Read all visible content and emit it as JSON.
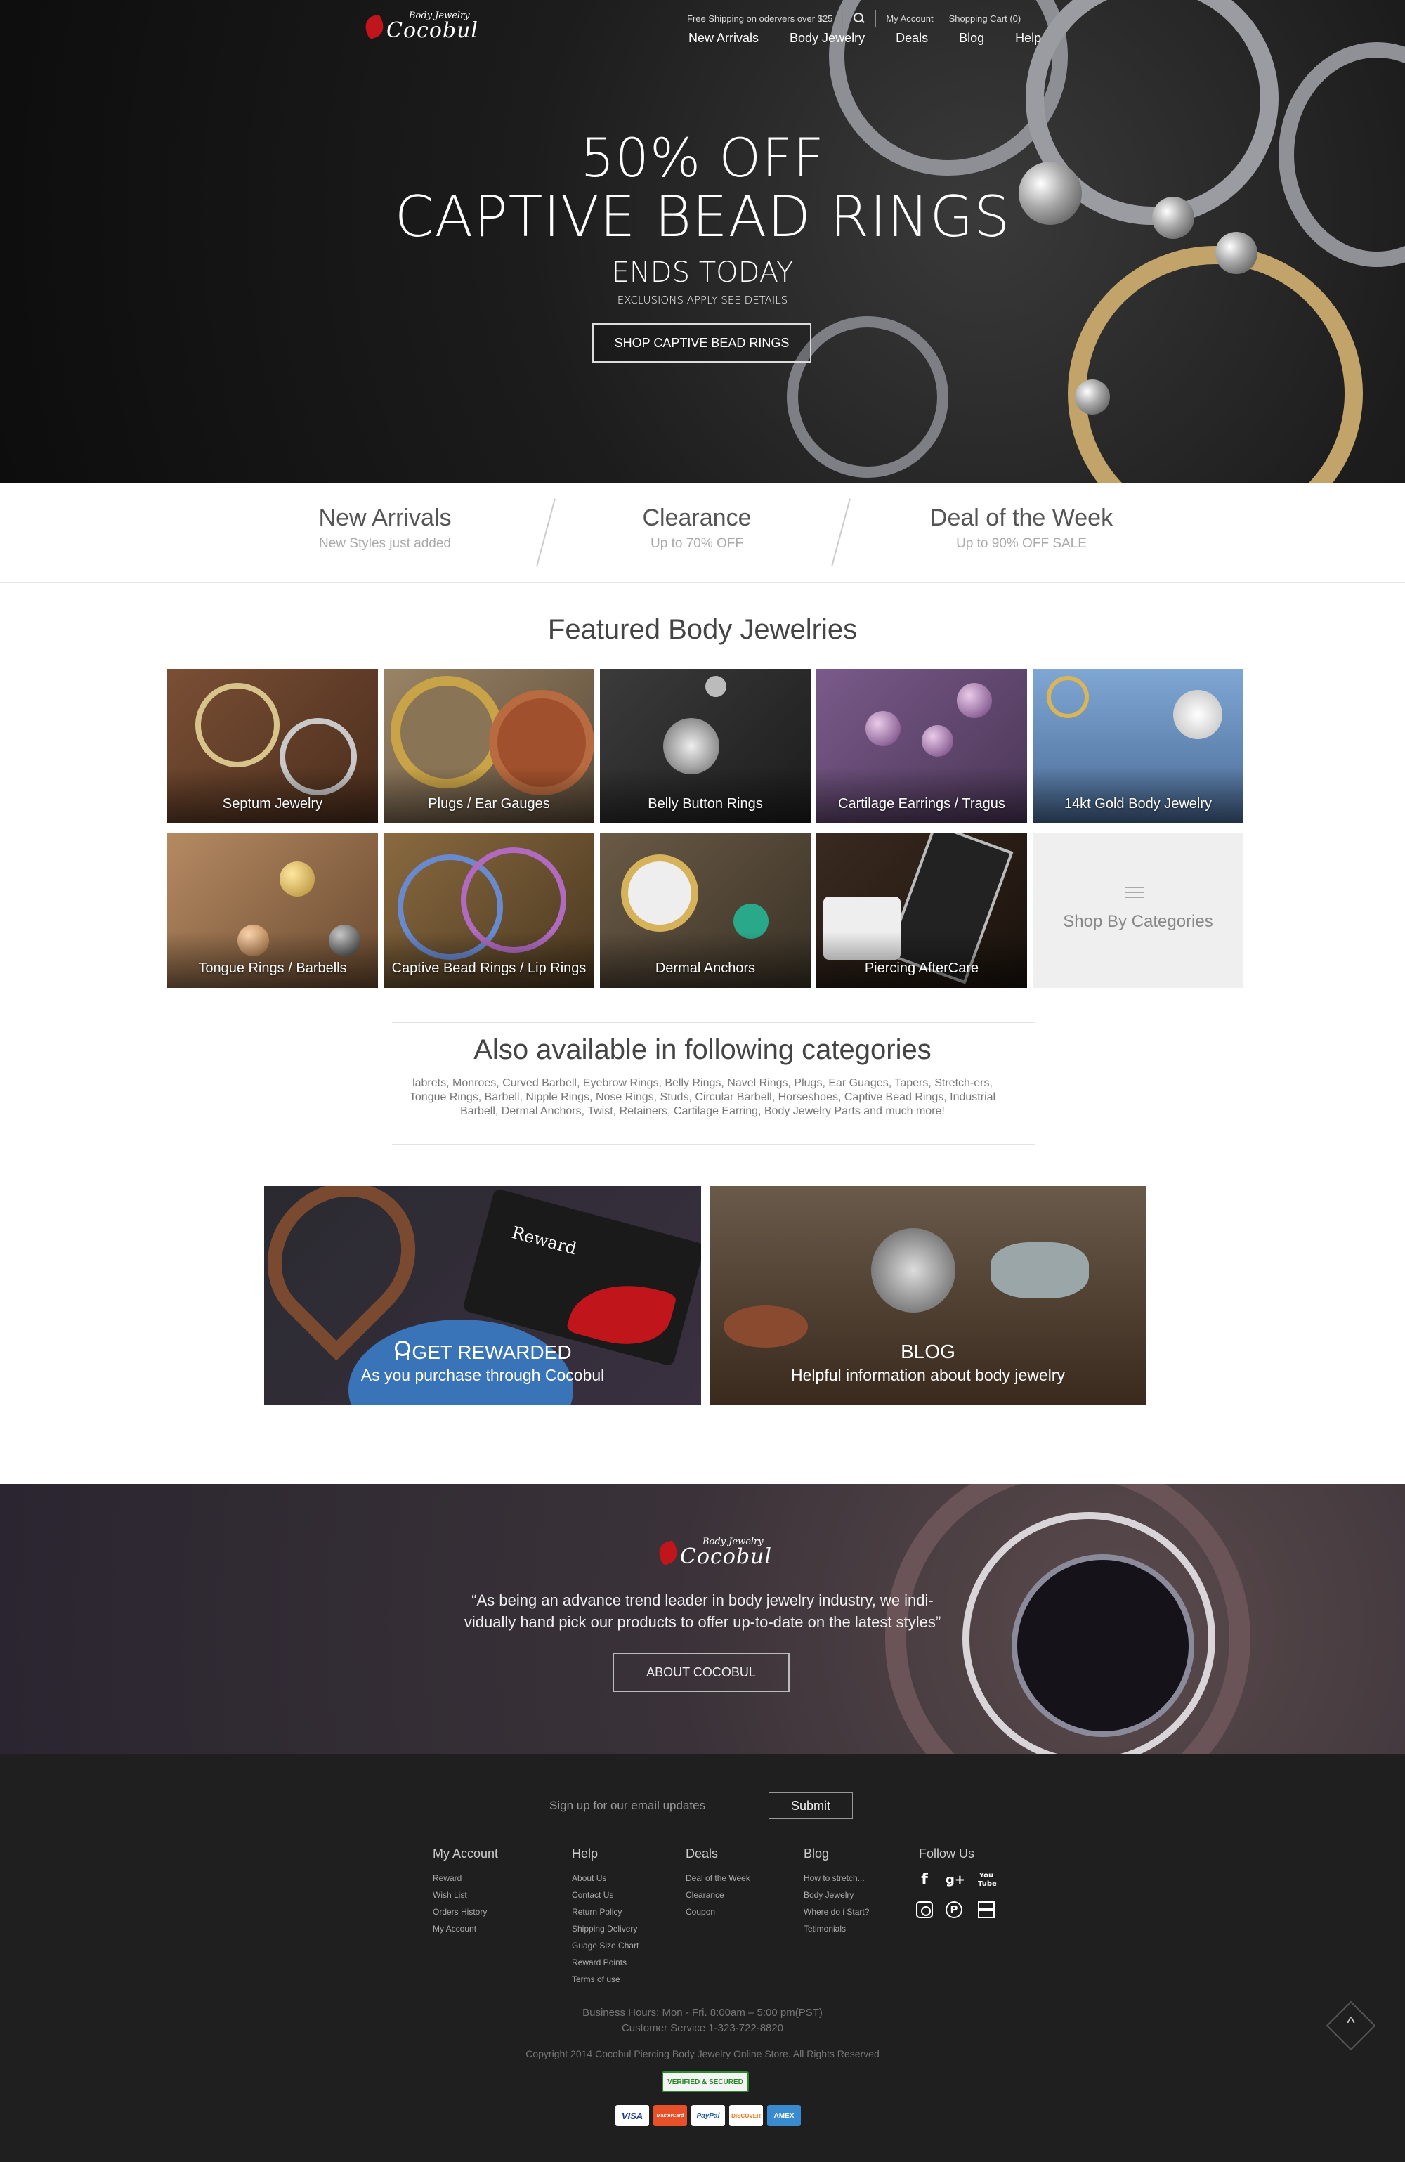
{
  "header": {
    "logo_top": "Body Jewelry",
    "logo_main": "Cocobul",
    "utility": {
      "shipping_note": "Free Shipping on odervers over $25",
      "my_account": "My Account",
      "cart": "Shopping Cart (0)"
    },
    "nav": [
      "New Arrivals",
      "Body Jewelry",
      "Deals",
      "Blog",
      "Help"
    ]
  },
  "hero": {
    "line1": "50% OFF",
    "line2": "CAPTIVE BEAD RINGS",
    "line3": "ENDS TODAY",
    "note": "EXCLUSIONS APPLY SEE DETAILS",
    "cta": "SHOP CAPTIVE BEAD RINGS"
  },
  "promos": [
    {
      "title": "New Arrivals",
      "sub": "New Styles just added"
    },
    {
      "title": "Clearance",
      "sub": "Up to 70% OFF"
    },
    {
      "title": "Deal of the Week",
      "sub": "Up to 90% OFF SALE"
    }
  ],
  "featured": {
    "title": "Featured Body Jewelries",
    "tiles": [
      "Septum Jewelry",
      "Plugs / Ear Gauges",
      "Belly Button Rings",
      "Cartilage Earrings / Tragus",
      "14kt Gold Body Jewelry",
      "Tongue Rings / Barbells",
      "Captive Bead Rings / Lip Rings",
      "Dermal Anchors",
      "Piercing AfterCare",
      "Shop By Categories"
    ]
  },
  "also": {
    "title": "Also available in following categories",
    "text": "labrets, Monroes, Curved Barbell, Eyebrow Rings, Belly Rings, Navel Rings, Plugs, Ear Guages, Tapers, Stretch-ers, Tongue Rings, Barbell, Nipple Rings, Nose Rings, Studs, Circular Barbell, Horseshoes, Captive Bead Rings, Industrial Barbell, Dermal Anchors, Twist, Retainers, Cartilage Earring, Body Jewelry Parts and much more!"
  },
  "banners": {
    "reward_title": "GET REWARDED",
    "reward_sub": "As you purchase through Cocobul",
    "reward_card": "Reward",
    "blog_title": "BLOG",
    "blog_sub": "Helpful information about body jewelry"
  },
  "about": {
    "quote": "“As being an advance trend leader in body jewelry industry, we indi-vidually hand pick our products to offer up-to-date on the latest styles”",
    "button": "ABOUT COCOBUL"
  },
  "footer": {
    "email_placeholder": "Sign up for our email updates",
    "submit": "Submit",
    "columns": [
      {
        "head": "My Account",
        "links": [
          "Reward",
          "Wish List",
          "Orders History",
          "My Account"
        ]
      },
      {
        "head": "Help",
        "links": [
          "About Us",
          "Contact Us",
          "Return Policy",
          "Shipping Delivery",
          "Guage Size Chart",
          "Reward Points",
          "Terms of use"
        ]
      },
      {
        "head": "Deals",
        "links": [
          "Deal of the Week",
          "Clearance",
          "Coupon"
        ]
      },
      {
        "head": "Blog",
        "links": [
          "How to stretch...",
          "Body Jewelry",
          "Where do i Start?",
          "Tetimonials"
        ]
      },
      {
        "head": "Follow Us",
        "links": []
      }
    ],
    "hours": "Business Hours: Mon - Fri. 8:00am – 5:00 pm(PST)",
    "phone": "Customer Service 1-323-722-8820",
    "copyright": "Copyright 2014 Cocobul Piercing Body Jewelry Online Store. All Rights Reserved",
    "trust_badge": "VERIFIED & SECURED",
    "payments": [
      "VISA",
      "MasterCard",
      "PayPal",
      "DISCOVER",
      "AMEX"
    ],
    "to_top": "^"
  },
  "colors": {
    "accent": "#c0161b",
    "footer_bg": "#1f1f1f",
    "tile_bg": "#efefef"
  }
}
